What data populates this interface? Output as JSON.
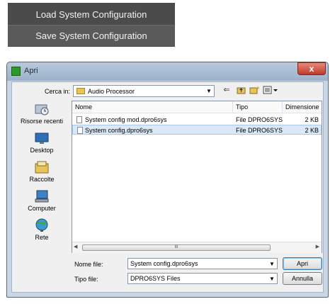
{
  "menu": {
    "items": [
      "Load System Configuration",
      "Save System Configuration"
    ]
  },
  "dialog": {
    "title": "Apri",
    "close_symbol": "x",
    "lookin_label": "Cerca in:",
    "lookin_value": "Audio Processor",
    "toolbar_icons": [
      "back-arrow-icon",
      "up-folder-icon",
      "new-folder-icon",
      "view-menu-icon"
    ],
    "places": [
      {
        "label": "Risorse recenti",
        "icon": "recent-icon"
      },
      {
        "label": "Desktop",
        "icon": "desktop-icon"
      },
      {
        "label": "Raccolte",
        "icon": "libraries-icon"
      },
      {
        "label": "Computer",
        "icon": "computer-icon"
      },
      {
        "label": "Rete",
        "icon": "network-icon"
      }
    ],
    "columns": [
      "Nome",
      "Tipo",
      "Dimensione"
    ],
    "files": [
      {
        "name": "System config mod.dpro6sys",
        "type": "File DPRO6SYS",
        "size": "2 KB",
        "selected": false
      },
      {
        "name": "System config.dpro6sys",
        "type": "File DPRO6SYS",
        "size": "2 KB",
        "selected": true
      }
    ],
    "filename_label": "Nome file:",
    "filename_value": "System config.dpro6sys",
    "filetype_label": "Tipo file:",
    "filetype_value": "DPRO6SYS Files",
    "open_button": "Apri",
    "cancel_button": "Annulla",
    "scroll_thumb_glyph": "III"
  },
  "colors": {
    "menu_bg": "#4b4b4b",
    "title_bar": "#9cb2ca",
    "selection": "#dbe8f7",
    "close": "#c0392b"
  }
}
